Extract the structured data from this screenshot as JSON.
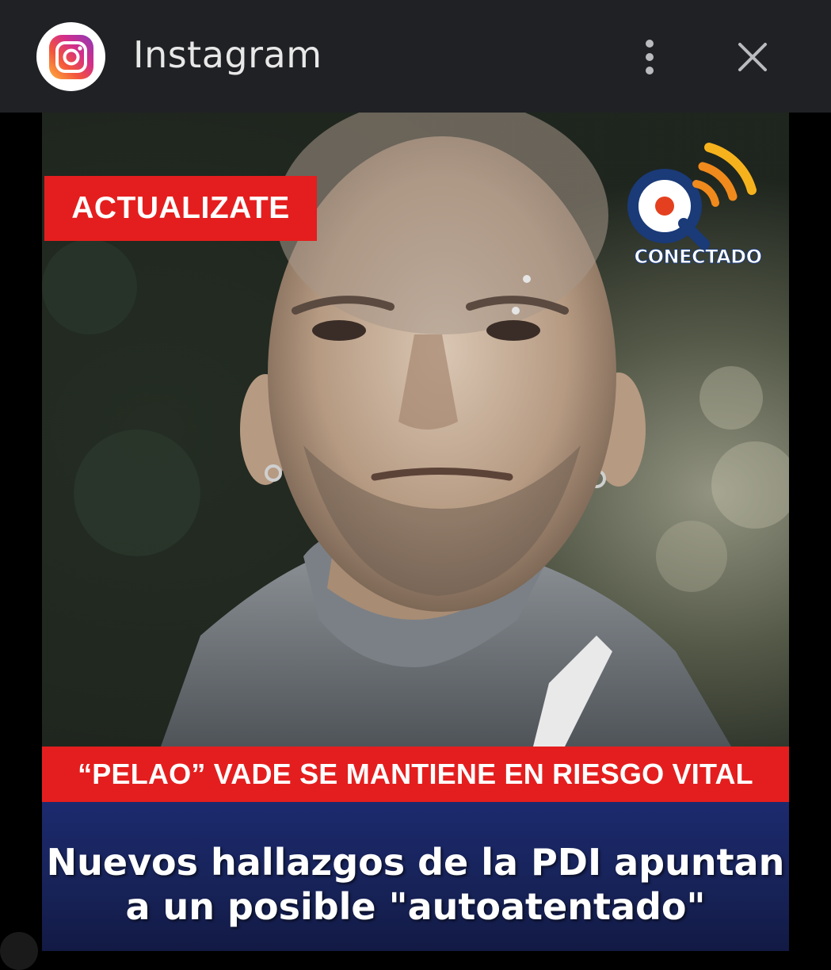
{
  "window": {
    "app_name": "Instagram",
    "app_icon": "instagram-icon",
    "menu_icon": "more-vertical-icon",
    "close_icon": "close-icon"
  },
  "post": {
    "tag": "ACTUALIZATE",
    "brand": "CONECTADO",
    "subheadline": "“PELAO” VADE SE MANTIENE EN RIESGO VITAL",
    "headline_line1": "Nuevos hallazgos de la PDI apuntan",
    "headline_line2": "a un posible \"autoatentado\"",
    "colors": {
      "tag_bg": "#e41e1e",
      "headline_bg": "#1c2a6e",
      "brand_blue": "#1a3a78",
      "brand_orange": "#f08a1c"
    }
  }
}
